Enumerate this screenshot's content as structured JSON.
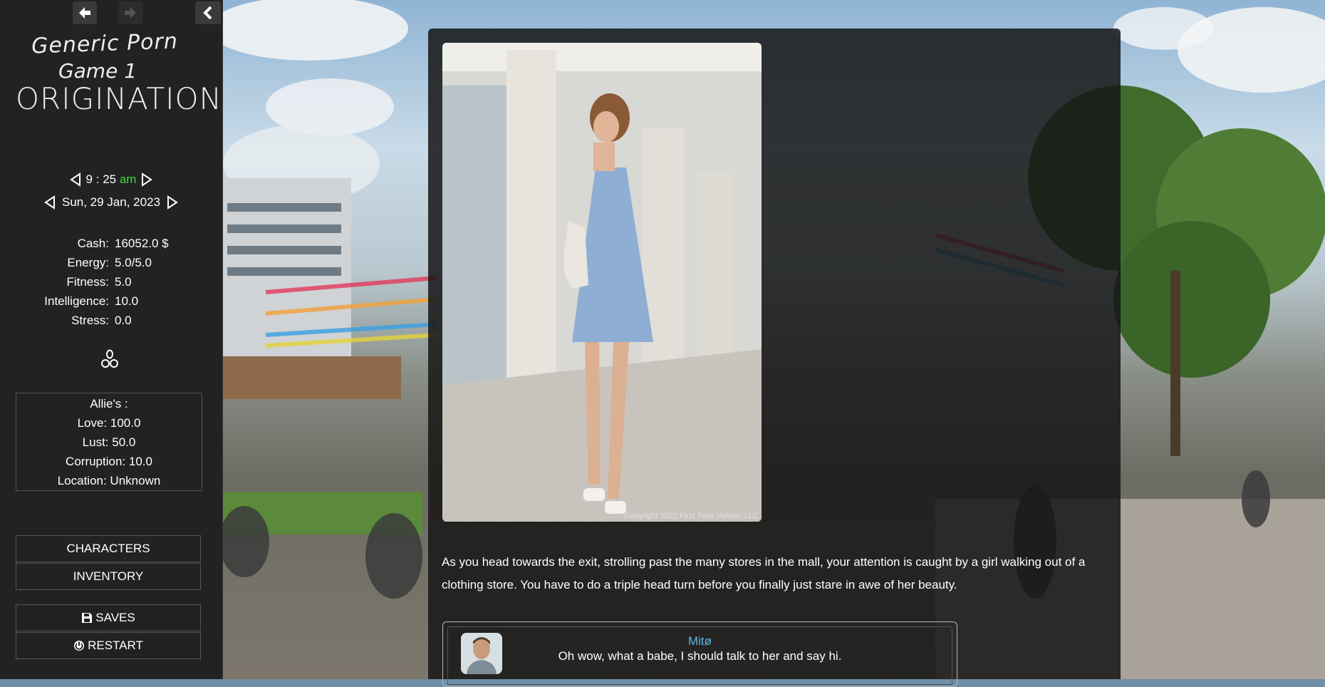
{
  "sidebar": {
    "logo": {
      "line1": "Generic Porn",
      "line2": "Game 1",
      "line3": "ORIGINATION"
    },
    "time": {
      "hour": "9",
      "minute": "25",
      "ampm": "am"
    },
    "date": "Sun, 29 Jan, 2023",
    "stats": [
      {
        "label": "Cash:",
        "value": "16052.0 $"
      },
      {
        "label": "Energy:",
        "value": "5.0/5.0"
      },
      {
        "label": "Fitness:",
        "value": "5.0"
      },
      {
        "label": "Intelligence:",
        "value": "10.0"
      },
      {
        "label": "Stress:",
        "value": "0.0"
      }
    ],
    "character": {
      "name": "Allie's :",
      "love": "Love: 100.0",
      "lust": "Lust: 50.0",
      "corruption": "Corruption: 10.0",
      "location": "Location: Unknown"
    },
    "buttons": {
      "characters": "CHARACTERS",
      "inventory": "INVENTORY",
      "saves": "SAVES",
      "restart": "RESTART"
    }
  },
  "main": {
    "photo_copyright": "Copyright 2022 First Time Videos, LLC",
    "story": "As you head towards the exit, strolling past the many stores in the mall, your attention is caught by a girl walking out of a clothing store. You have to do a triple head turn before you finally just stare in awe of her beauty.",
    "dialogue": {
      "speaker": "Mitø",
      "text": "Oh wow, what a babe, I should talk to her and say hi."
    }
  },
  "colors": {
    "accent_green": "#3cdc3c",
    "speaker_blue": "#5cb8ea",
    "sidebar_bg": "#222222"
  }
}
